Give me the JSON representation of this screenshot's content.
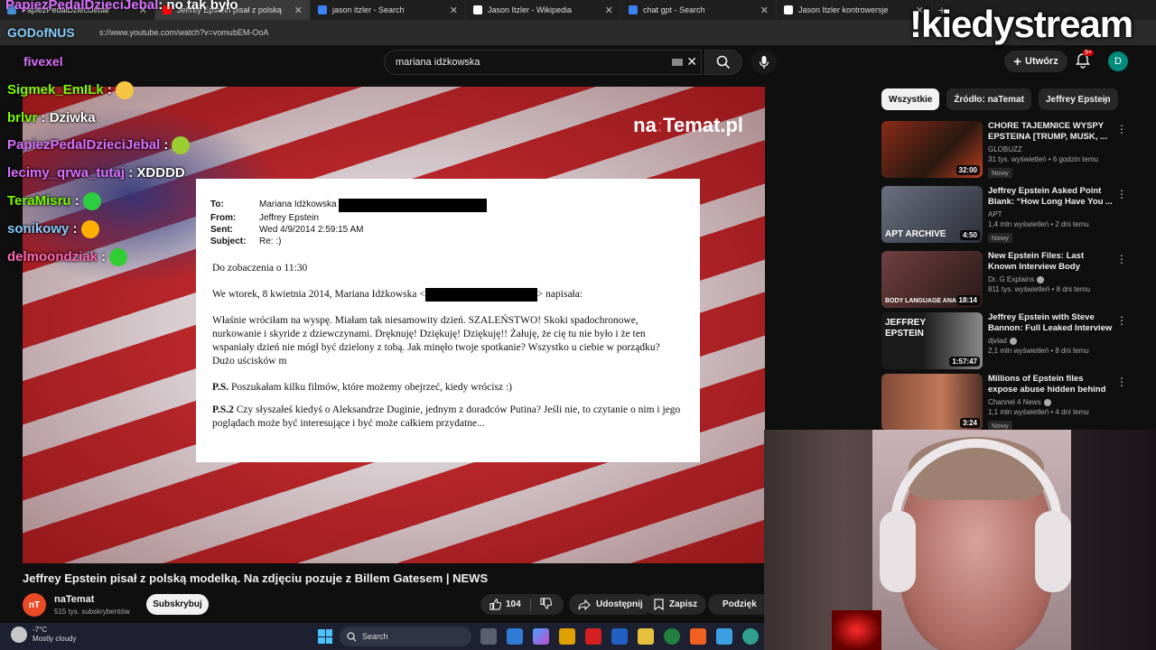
{
  "browser": {
    "tabs": [
      {
        "title": "PapiezPedalDzieciJebal",
        "color": "#4a90d9"
      },
      {
        "title": "Jeffrey Epstein pisał z polską",
        "color": "#ff0000"
      },
      {
        "title": "jason itzler - Search",
        "color": "#3b82f6"
      },
      {
        "title": "Jason Itzler - Wikipedia",
        "color": "#ffffff"
      },
      {
        "title": "chat gpt - Search",
        "color": "#3b82f6"
      },
      {
        "title": "Jason Itzler kontrowersje",
        "color": "#ffffff"
      }
    ],
    "url": "s://www.youtube.com/watch?v=vomubEM-OoA"
  },
  "youtube": {
    "search_value": "mariana idżkowska",
    "create_label": "Utwórz",
    "notif_badge": "9+",
    "avatar_letter": "D"
  },
  "video": {
    "watermark_a": "na",
    "watermark_b": ":",
    "watermark_c": "Temat.pl",
    "email": {
      "to_label": "To:",
      "to_value": "Mariana Idżkowska",
      "from_label": "From:",
      "from_value": "Jeffrey Epstein",
      "sent_label": "Sent:",
      "sent_value": "Wed 4/9/2014 2:59:15 AM",
      "subject_label": "Subject:",
      "subject_value": "Re: :)",
      "line1": "Do zobaczenia o 11:30",
      "line2a": "We wtorek, 8 kwietnia 2014, Mariana Idżkowska <",
      "line2b": "> napisała:",
      "para": "Właśnie wróciłam na wyspę. Miałam tak niesamowity dzień. SZALEŃSTWO! Skoki spadochronowe, nurkowanie i skyride z dziewczynami. Dręknuję! Dziękuję! Dziękuję!! Żałuję, że cię tu nie było i że ten wspaniały dzień nie mógł być dzielony z tobą. Jak minęło twoje spotkanie? Wszystko u ciebie w porządku?",
      "sign": "Dużo uścisków m",
      "ps1_label": "P.S.",
      "ps1": "Poszukałam kilku filmów, które możemy obejrzeć, kiedy wrócisz :)",
      "ps2_label": "P.S.2",
      "ps2": "Czy słyszałeś kiedyś o Aleksandrze Duginie, jednym z doradców Putina? Jeśli nie, to czytanie o nim i jego poglądach może być interesujące i być może całkiem przydatne..."
    },
    "title": "Jeffrey Epstein pisał z polską modelką. Na zdjęciu pozuje z Billem Gatesem | NEWS",
    "channel": "naTemat",
    "channel_avatar": "nT",
    "subscribers": "515 tys. subskrybentów",
    "subscribe": "Subskrybuj",
    "likes": "104",
    "share": "Udostępnij",
    "save": "Zapisz",
    "thanks": "Podzięk"
  },
  "sidebar": {
    "chips": [
      "Wszystkie",
      "Źródło: naTemat",
      "Jeffrey Epstein"
    ],
    "recs": [
      {
        "title": "CHORE TAJEMNICE WYSPY EPSTEINA [TRUMP, MUSK, ...",
        "channel": "GLOBUZZ",
        "meta": "31 tys. wyświetleń • 6 godzin temu",
        "badge": "Nowy",
        "duration": "32:00",
        "thumb": "#7a2a1a",
        "tag": ""
      },
      {
        "title": "Jeffrey Epstein Asked Point Blank: “How Long Have You ...",
        "channel": "APT",
        "meta": "1,4 mln wyświetleń • 2 dni temu",
        "badge": "Nowy",
        "duration": "4:50",
        "thumb": "#4a5060",
        "tag": "APT ARCHIVE"
      },
      {
        "title": "New Epstein Files: Last Known Interview Body Language ...",
        "channel": "Dr. G Explains",
        "meta": "811 tys. wyświetleń • 8 dni temu",
        "badge": "",
        "duration": "18:14",
        "thumb": "#5a3a3a",
        "tag": "BODY LANGUAGE ANALYSIS"
      },
      {
        "title": "Jeffrey Epstein with Steve Bannon: Full Leaked Interview",
        "channel": "djvlad",
        "meta": "2,1 mln wyświetleń • 8 dni temu",
        "badge": "",
        "duration": "1:57:47",
        "thumb": "#2a2a2a",
        "tag": "JEFFREY EPSTEIN"
      },
      {
        "title": "Millions of Epstein files expose abuse hidden behind luxurious...",
        "channel": "Channel 4 News",
        "meta": "1,1 mln wyświetleń • 4 dni temu",
        "badge": "Nowy",
        "duration": "3:24",
        "thumb": "#6a4030",
        "tag": ""
      }
    ]
  },
  "stream": {
    "overlay_title": "!kiedystream",
    "top_user": "PapiezPedalDzieciJebal",
    "top_msg": ": no tak było",
    "god_user": "GODofNUS",
    "fivex": "fivexel",
    "chat": [
      {
        "user": "Sigmek_EmILk",
        "msg": " :",
        "color": "#7CFC00",
        "emote": "#f5c542"
      },
      {
        "user": "brlvr",
        "msg": " : Dziwka",
        "color": "#7CFC00",
        "emote": ""
      },
      {
        "user": "PapiezPedalDzieciJebal",
        "msg": " :",
        "color": "#da70ff",
        "emote": "#9acd32"
      },
      {
        "user": "lecimy_qrwa_tutaj",
        "msg": " : XDDDD",
        "color": "#da70ff",
        "emote": ""
      },
      {
        "user": "TeraMisru",
        "msg": " :",
        "color": "#7CFC00",
        "emote": "#2ecc40"
      },
      {
        "user": "sonikowy",
        "msg": " :",
        "color": "#87cefa",
        "emote": "#ffb000"
      },
      {
        "user": "delmoondziak",
        "msg": " :",
        "color": "#ff69b4",
        "emote": "#32cd32"
      }
    ]
  },
  "taskbar": {
    "temp": "-7°C",
    "weather": "Mostly cloudy",
    "search": "Search"
  }
}
